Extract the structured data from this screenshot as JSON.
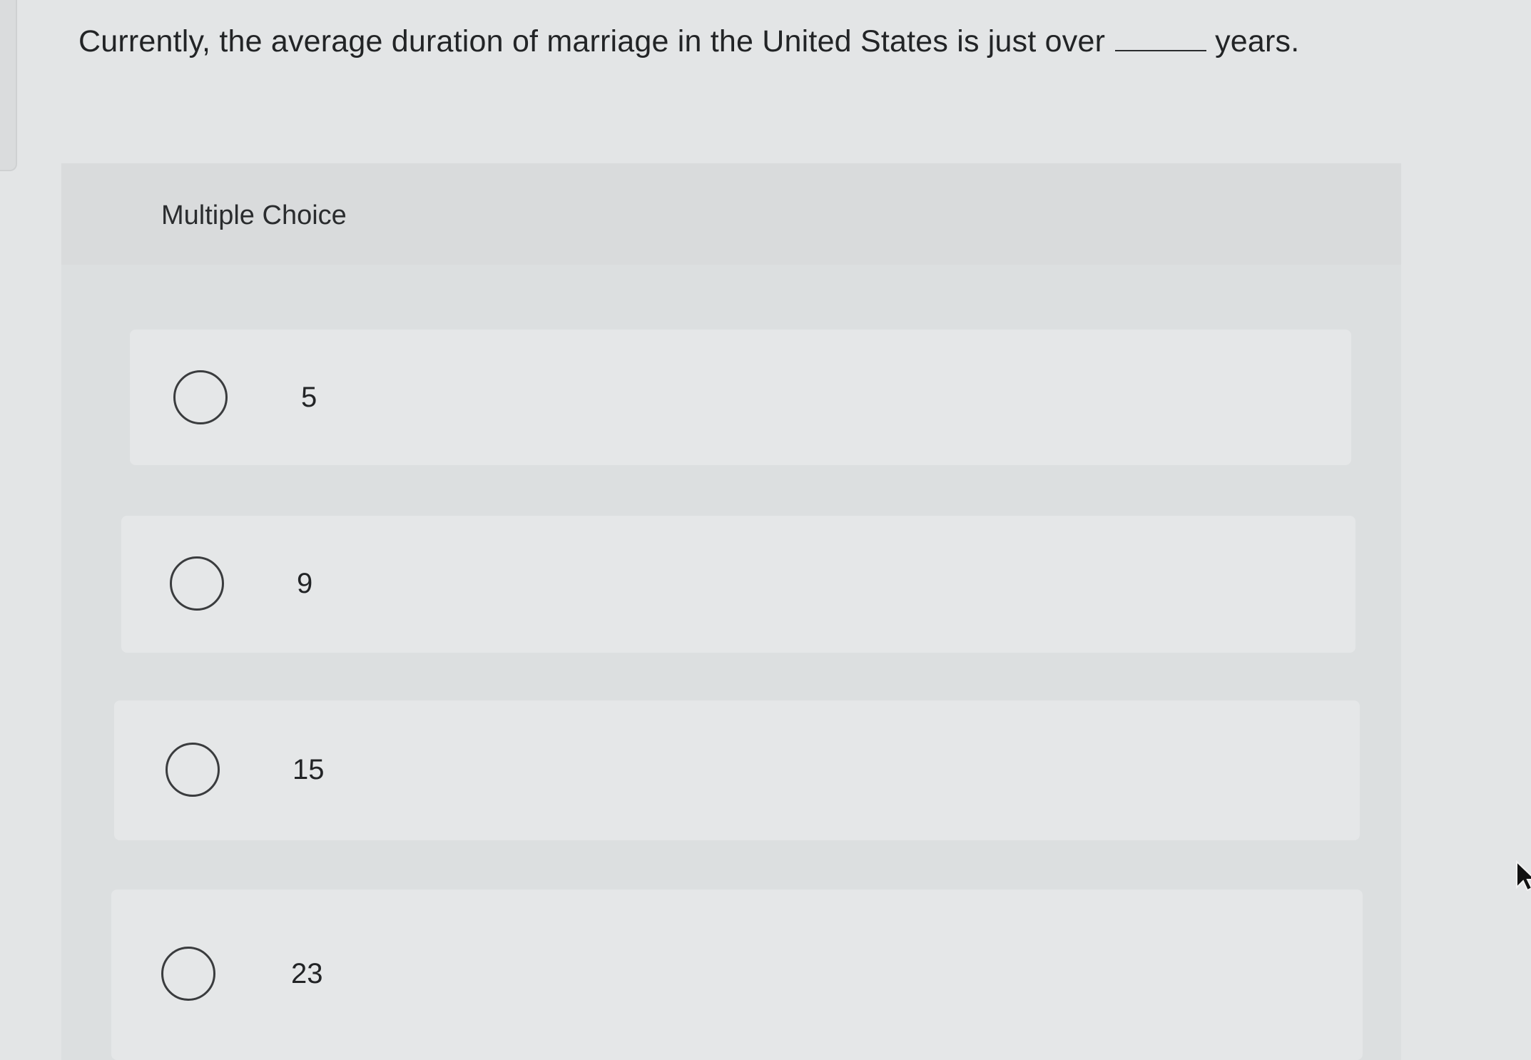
{
  "question": {
    "before_blank": "Currently, the average duration of marriage in the United States is just over",
    "after_blank": "years."
  },
  "multiple_choice": {
    "title": "Multiple Choice",
    "options": [
      {
        "label": "5"
      },
      {
        "label": "9"
      },
      {
        "label": "15"
      },
      {
        "label": "23"
      }
    ]
  },
  "icons": {
    "radio": "radio-unchecked-icon",
    "cursor": "mouse-pointer-icon"
  }
}
